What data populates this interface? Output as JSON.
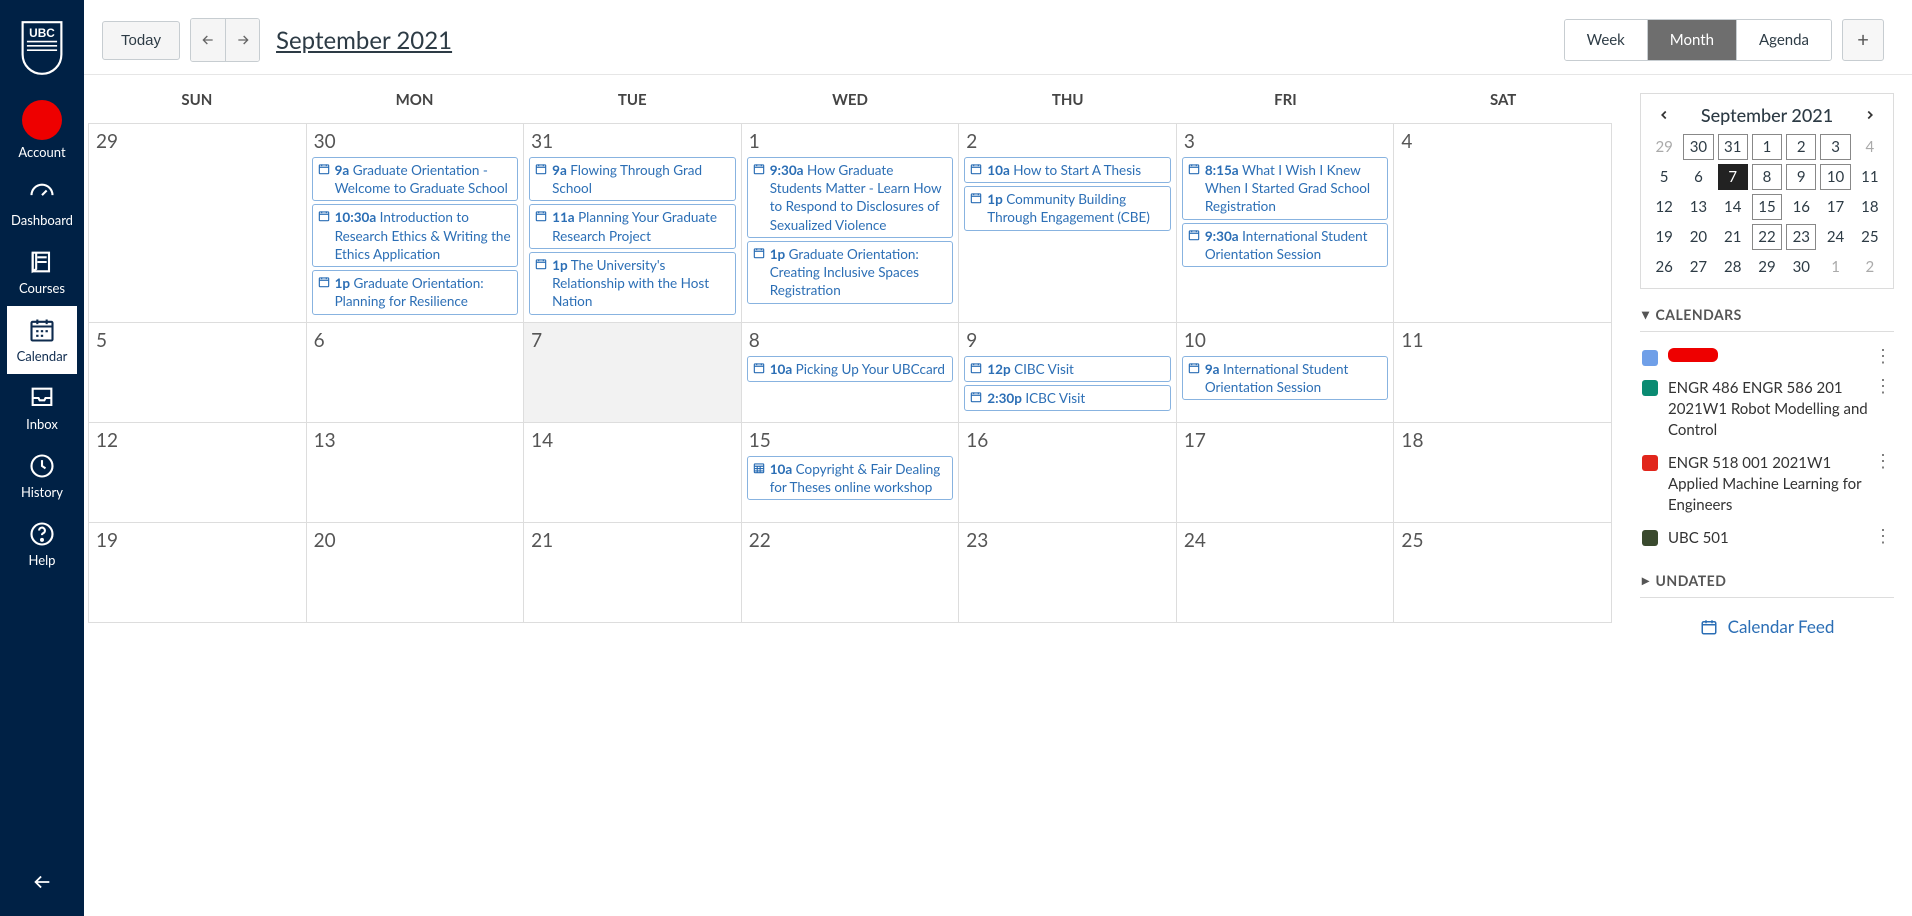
{
  "sidebar": [
    {
      "key": "account",
      "label": "Account"
    },
    {
      "key": "dashboard",
      "label": "Dashboard"
    },
    {
      "key": "courses",
      "label": "Courses"
    },
    {
      "key": "calendar",
      "label": "Calendar"
    },
    {
      "key": "inbox",
      "label": "Inbox"
    },
    {
      "key": "history",
      "label": "History"
    },
    {
      "key": "help",
      "label": "Help"
    }
  ],
  "topbar": {
    "today": "Today",
    "title": "September 2021",
    "views": [
      "Week",
      "Month",
      "Agenda"
    ],
    "active_view": "Month"
  },
  "dow": [
    "SUN",
    "MON",
    "TUE",
    "WED",
    "THU",
    "FRI",
    "SAT"
  ],
  "weeks": [
    {
      "days": [
        {
          "n": "29",
          "events": []
        },
        {
          "n": "30",
          "events": [
            {
              "t": "9a",
              "txt": "Graduate Orientation - Welcome to Graduate School"
            },
            {
              "t": "10:30a",
              "txt": "Introduction to Research Ethics & Writing the Ethics Application"
            },
            {
              "t": "1p",
              "txt": "Graduate Orientation: Planning for Resilience"
            }
          ]
        },
        {
          "n": "31",
          "events": [
            {
              "t": "9a",
              "txt": "Flowing Through Grad School"
            },
            {
              "t": "11a",
              "txt": "Planning Your Graduate Research Project"
            },
            {
              "t": "1p",
              "txt": "The University's Relationship with the Host Nation"
            }
          ]
        },
        {
          "n": "1",
          "events": [
            {
              "t": "9:30a",
              "txt": "How Graduate Students Matter - Learn How to Respond to Disclosures of Sexualized Violence"
            },
            {
              "t": "1p",
              "txt": "Graduate Orientation: Creating Inclusive Spaces Registration"
            }
          ]
        },
        {
          "n": "2",
          "events": [
            {
              "t": "10a",
              "txt": "How to Start A Thesis"
            },
            {
              "t": "1p",
              "txt": "Community Building Through Engagement (CBE)"
            }
          ]
        },
        {
          "n": "3",
          "events": [
            {
              "t": "8:15a",
              "txt": "What I Wish I Knew When I Started Grad School Registration"
            },
            {
              "t": "9:30a",
              "txt": "International Student Orientation Session"
            }
          ]
        },
        {
          "n": "4",
          "events": []
        }
      ]
    },
    {
      "days": [
        {
          "n": "5",
          "events": []
        },
        {
          "n": "6",
          "events": []
        },
        {
          "n": "7",
          "events": [],
          "today": true
        },
        {
          "n": "8",
          "events": [
            {
              "t": "10a",
              "txt": "Picking Up Your UBCcard"
            }
          ]
        },
        {
          "n": "9",
          "events": [
            {
              "t": "12p",
              "txt": "CIBC Visit"
            },
            {
              "t": "2:30p",
              "txt": "ICBC Visit"
            }
          ]
        },
        {
          "n": "10",
          "events": [
            {
              "t": "9a",
              "txt": "International Student Orientation Session"
            }
          ]
        },
        {
          "n": "11",
          "events": []
        }
      ]
    },
    {
      "days": [
        {
          "n": "12",
          "events": []
        },
        {
          "n": "13",
          "events": []
        },
        {
          "n": "14",
          "events": []
        },
        {
          "n": "15",
          "events": [
            {
              "t": "10a",
              "txt": "Copyright & Fair Dealing for Theses online workshop",
              "grid": true
            }
          ]
        },
        {
          "n": "16",
          "events": []
        },
        {
          "n": "17",
          "events": []
        },
        {
          "n": "18",
          "events": []
        }
      ]
    },
    {
      "days": [
        {
          "n": "19",
          "events": []
        },
        {
          "n": "20",
          "events": []
        },
        {
          "n": "21",
          "events": []
        },
        {
          "n": "22",
          "events": []
        },
        {
          "n": "23",
          "events": []
        },
        {
          "n": "24",
          "events": []
        },
        {
          "n": "25",
          "events": []
        }
      ]
    }
  ],
  "mini": {
    "title": "September 2021",
    "rows": [
      [
        {
          "n": "29",
          "om": true
        },
        {
          "n": "30",
          "box": true
        },
        {
          "n": "31",
          "box": true
        },
        {
          "n": "1",
          "box": true
        },
        {
          "n": "2",
          "box": true
        },
        {
          "n": "3",
          "box": true
        },
        {
          "n": "4",
          "om": true
        }
      ],
      [
        {
          "n": "5"
        },
        {
          "n": "6"
        },
        {
          "n": "7",
          "today": true
        },
        {
          "n": "8",
          "box": true
        },
        {
          "n": "9",
          "box": true
        },
        {
          "n": "10",
          "box": true
        },
        {
          "n": "11"
        }
      ],
      [
        {
          "n": "12"
        },
        {
          "n": "13"
        },
        {
          "n": "14"
        },
        {
          "n": "15",
          "box": true
        },
        {
          "n": "16"
        },
        {
          "n": "17"
        },
        {
          "n": "18"
        }
      ],
      [
        {
          "n": "19"
        },
        {
          "n": "20"
        },
        {
          "n": "21"
        },
        {
          "n": "22",
          "box": true
        },
        {
          "n": "23",
          "box": true
        },
        {
          "n": "24"
        },
        {
          "n": "25"
        }
      ],
      [
        {
          "n": "26"
        },
        {
          "n": "27"
        },
        {
          "n": "28"
        },
        {
          "n": "29"
        },
        {
          "n": "30"
        },
        {
          "n": "1",
          "om": true
        },
        {
          "n": "2",
          "om": true
        }
      ]
    ]
  },
  "sections": {
    "calendars": "CALENDARS",
    "undated": "UNDATED"
  },
  "calendars": [
    {
      "color": "#6f9fe8",
      "label": "",
      "redacted": true
    },
    {
      "color": "#0a8b72",
      "label": "ENGR 486 ENGR 586 201 2021W1 Robot Modelling and Control"
    },
    {
      "color": "#e1261c",
      "label": "ENGR 518 001 2021W1 Applied Machine Learning for Engineers"
    },
    {
      "color": "#3a4a2e",
      "label": "UBC 501"
    }
  ],
  "feed": "Calendar Feed"
}
